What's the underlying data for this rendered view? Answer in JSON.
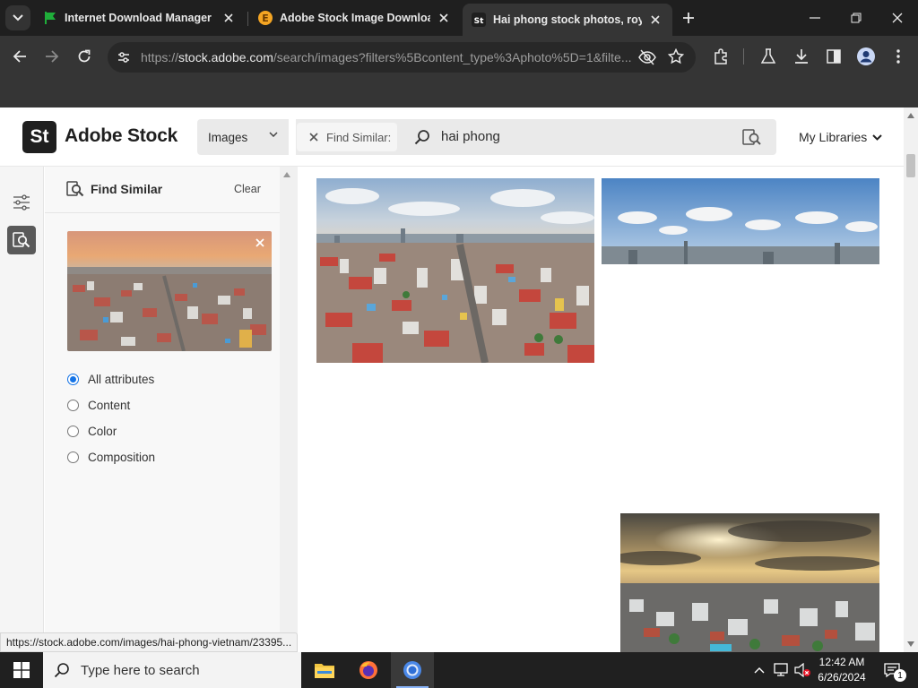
{
  "browser": {
    "tabs": [
      {
        "title": "Internet Download Manager is",
        "icon": "idm-flag-icon",
        "active": false
      },
      {
        "title": "Adobe Stock Image Download",
        "icon": "extension-e-icon",
        "active": false
      },
      {
        "title": "Hai phong stock photos, royalt",
        "icon": "adobe-stock-icon",
        "active": true
      }
    ],
    "address": {
      "host": "stock.adobe.com",
      "path": "/search/images?filters%5Bcontent_type%3Aphoto%5D=1&filte..."
    },
    "status_url": "https://stock.adobe.com/images/hai-phong-vietnam/23395..."
  },
  "header": {
    "logo_text": "St",
    "brand": "Adobe Stock",
    "asset_type": "Images",
    "chip_label": "Find Similar:",
    "query": "hai phong",
    "my_libraries": "My Libraries"
  },
  "panel": {
    "title": "Find Similar",
    "clear": "Clear",
    "options": [
      {
        "label": "All attributes",
        "checked": true
      },
      {
        "label": "Content",
        "checked": false
      },
      {
        "label": "Color",
        "checked": false
      },
      {
        "label": "Composition",
        "checked": false
      }
    ]
  },
  "taskbar": {
    "search_placeholder": "Type here to search",
    "time": "12:42 AM",
    "date": "6/26/2024",
    "notification_count": "1"
  },
  "colors": {
    "accent": "#1473e6",
    "chrome_dark": "#1f1f1f",
    "toolbar": "#353535"
  }
}
